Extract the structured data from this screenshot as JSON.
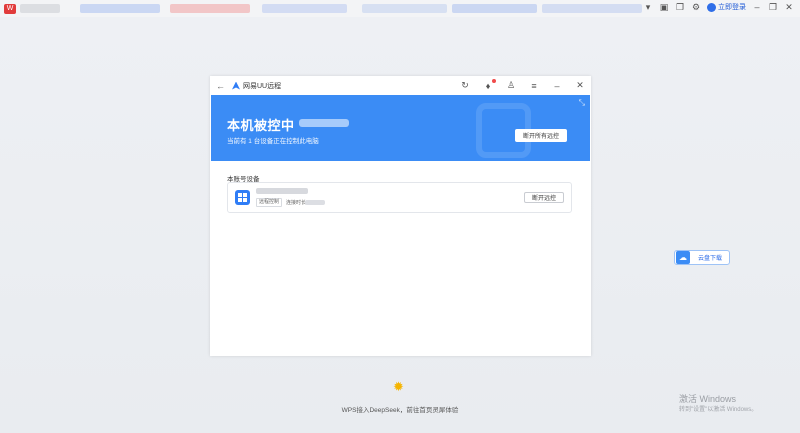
{
  "browser": {
    "logo": "W",
    "login_label": "立即登录",
    "colors": {
      "tab_red": "#f0a0a0",
      "tab_blue": "#a8bff0"
    }
  },
  "app": {
    "title": "网易UU远程",
    "banner": {
      "heading": "本机被控中",
      "subtitle": "当前有 1 台设备正在控制此电脑",
      "disconnect_all_label": "断开所有远控"
    },
    "section_label": "本账号设备",
    "device": {
      "tag": "远程控制",
      "time_label": "连接时长",
      "disconnect_label": "断开远控"
    },
    "accent_color": "#3b8cf5"
  },
  "widget": {
    "label": "云盘下载"
  },
  "footer": {
    "promo_text": "WPS接入DeepSeek，前往首页灵犀体验"
  },
  "watermark": {
    "line1": "激活 Windows",
    "line2": "转到\"设置\"以激活 Windows。"
  }
}
